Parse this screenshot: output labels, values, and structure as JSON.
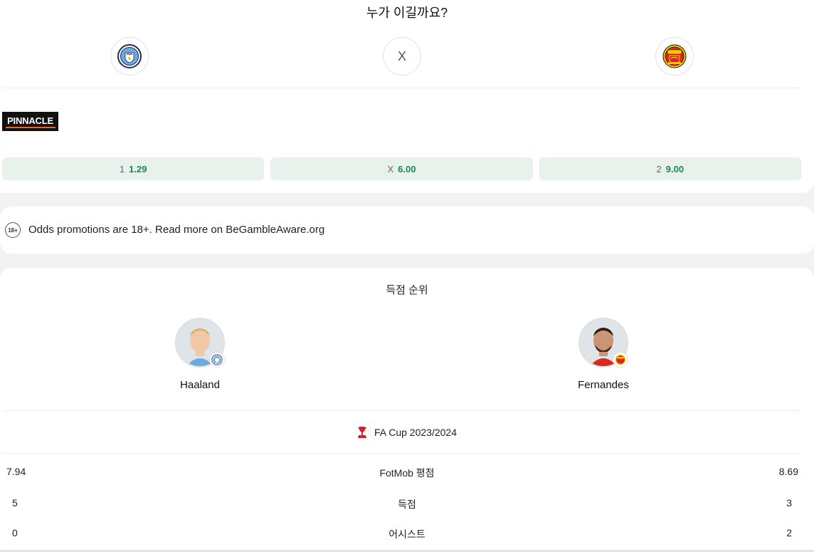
{
  "poll": {
    "title": "누가 이길까요?",
    "draw_symbol": "X",
    "home_team_icon": "manchester-city-crest-icon",
    "away_team_icon": "manchester-united-crest-icon"
  },
  "bookmaker": {
    "name": "PINNACLE",
    "accent_color": "#f26322",
    "odds": [
      {
        "outcome": "1",
        "price": "1.29"
      },
      {
        "outcome": "X",
        "price": "6.00"
      },
      {
        "outcome": "2",
        "price": "9.00"
      }
    ]
  },
  "promo": {
    "badge": "18+",
    "text": "Odds promotions are 18+. Read more on BeGambleAware.org"
  },
  "top_scorers": {
    "title": "득점 순위",
    "home_player": {
      "name": "Haaland",
      "team_icon": "manchester-city-crest-icon"
    },
    "away_player": {
      "name": "Fernandes",
      "team_icon": "manchester-united-crest-icon"
    },
    "league": {
      "name": "FA Cup 2023/2024",
      "icon": "fa-cup-icon"
    },
    "stats": [
      {
        "label": "FotMob 평점",
        "home": "7.94",
        "away": "8.69"
      },
      {
        "label": "득점",
        "home": "5",
        "away": "3"
      },
      {
        "label": "어시스트",
        "home": "0",
        "away": "2"
      }
    ]
  },
  "colors": {
    "odds_price": "#1e8a4c",
    "odds_background": "#e9f1ed",
    "city_blue": "#6cabdd",
    "united_red": "#da291c"
  }
}
